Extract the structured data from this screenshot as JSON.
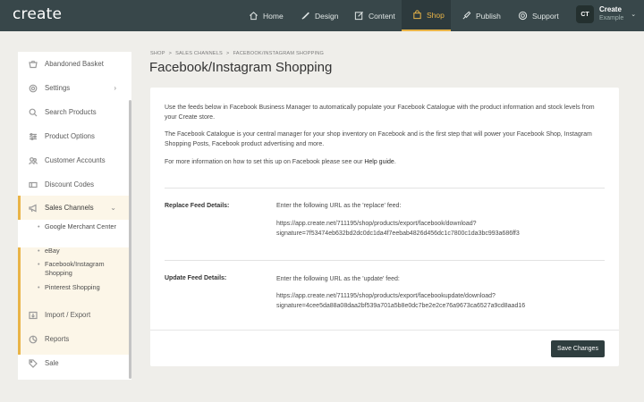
{
  "app": {
    "logo": "create"
  },
  "nav": [
    {
      "label": "Home",
      "icon": "home-icon"
    },
    {
      "label": "Design",
      "icon": "brush-icon"
    },
    {
      "label": "Content",
      "icon": "edit-icon"
    },
    {
      "label": "Shop",
      "icon": "bag-icon",
      "active": true
    },
    {
      "label": "Publish",
      "icon": "rocket-icon"
    },
    {
      "label": "Support",
      "icon": "lifebuoy-icon"
    }
  ],
  "user": {
    "initials": "CT",
    "name": "Create",
    "sub": "Example",
    "caret": "⌄"
  },
  "sidebar": {
    "items": [
      {
        "label": "Abandoned Basket",
        "icon": "basket-icon"
      },
      {
        "label": "Settings",
        "icon": "gear-icon",
        "chevron": "›"
      },
      {
        "label": "Search Products",
        "icon": "search-icon"
      },
      {
        "label": "Product Options",
        "icon": "sliders-icon"
      },
      {
        "label": "Customer Accounts",
        "icon": "users-icon"
      },
      {
        "label": "Discount Codes",
        "icon": "ticket-icon"
      },
      {
        "label": "Sales Channels",
        "icon": "megaphone-icon",
        "chevron": "⌄"
      },
      {
        "label": "Import / Export",
        "icon": "import-icon"
      },
      {
        "label": "Reports",
        "icon": "reports-icon"
      },
      {
        "label": "Sale",
        "icon": "tag-icon"
      }
    ],
    "subitems": [
      "Google Merchant Center",
      "eBay",
      "Facebook/Instagram Shopping",
      "Pinterest Shopping"
    ]
  },
  "breadcrumb": {
    "items": [
      "SHOP",
      "SALES CHANNELS",
      "FACEBOOK/INSTAGRAM SHOPPING"
    ],
    "separator": ">"
  },
  "page": {
    "title": "Facebook/Instagram Shopping",
    "intro": "Use the feeds below in Facebook Business Manager to automatically populate your Facebook Catalogue with the product information and stock levels from your Create store.",
    "catalogue": "The Facebook Catalogue is your central manager for your shop inventory on Facebook and is the first step that will power your Facebook Shop, Instagram Shopping Posts, Facebook product advertising and more.",
    "more_info_prefix": "For more information on how to set this up on Facebook please see our ",
    "help_link": "Help guide",
    "more_info_suffix": ".",
    "replace_label": "Replace Feed Details:",
    "replace_instruction": "Enter the following URL as the 'replace' feed:",
    "replace_url_1": "https://app.create.net/711195/shop/products/export/facebook/download?",
    "replace_url_2": "signature=7f53474eb632bd2dc0dc1da4f7eebab4826d456dc1c7800c1da3bc993a686ff3",
    "update_label": "Update Feed Details:",
    "update_instruction": "Enter the following URL as the 'update' feed:",
    "update_url_1": "https://app.create.net/711195/shop/products/export/facebookupdate/download?",
    "update_url_2": "signature=4cee5da88a08daa2bf539a701a5b8e0dc7be2e2ce76a9673ca6527a9cd8aad16",
    "save_label": "Save Changes"
  }
}
